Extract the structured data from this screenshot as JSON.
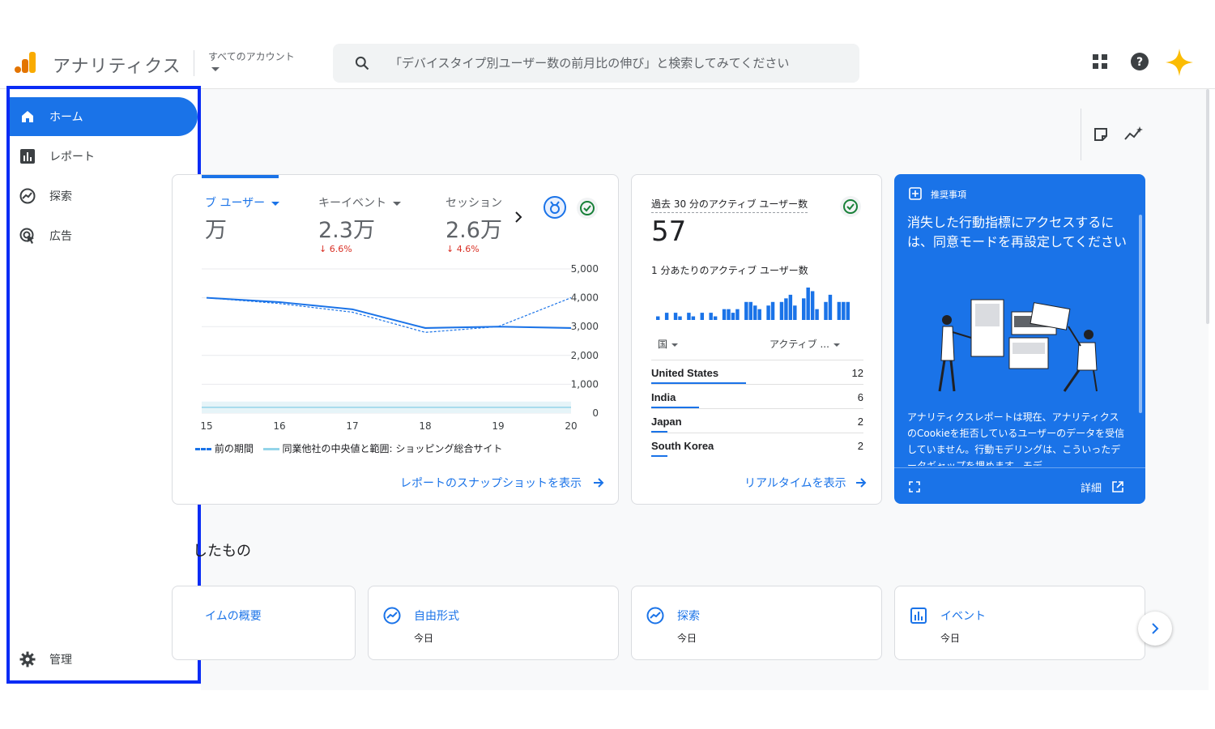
{
  "header": {
    "app_title": "アナリティクス",
    "account_label": "すべてのアカウント",
    "search_placeholder": "「デバイスタイプ別ユーザー数の前月比の伸び」と検索してみてください"
  },
  "sidebar": {
    "items": [
      {
        "label": "ホーム",
        "icon": "home-icon",
        "active": true
      },
      {
        "label": "レポート",
        "icon": "bar-chart-icon"
      },
      {
        "label": "探索",
        "icon": "explore-icon"
      },
      {
        "label": "広告",
        "icon": "ads-icon"
      }
    ],
    "admin_label": "管理"
  },
  "overview": {
    "metrics": [
      {
        "label": "ブ ユーザー",
        "value": "万"
      },
      {
        "label": "キーイベント",
        "value": "2.3万",
        "delta": "6.6%"
      },
      {
        "label": "セッション",
        "value": "2.6万",
        "delta": "4.6%"
      }
    ],
    "legend": {
      "previous": "前の期間",
      "benchmark": "同業他社の中央値と範囲: ショッピング総合サイト"
    },
    "link": "レポートのスナップショットを表示"
  },
  "chart_data": {
    "type": "line",
    "x": [
      "15",
      "16",
      "17",
      "18",
      "19",
      "20"
    ],
    "yticks": [
      "5,000",
      "4,000",
      "3,000",
      "2,000",
      "1,000",
      "0"
    ],
    "ylim": [
      0,
      5000
    ],
    "series": [
      {
        "name": "",
        "values": [
          4000,
          3850,
          3600,
          2950,
          3000,
          2950
        ]
      },
      {
        "name": "前の期間",
        "values": [
          4000,
          3800,
          3500,
          2800,
          3000,
          4000
        ]
      }
    ]
  },
  "realtime": {
    "title": "過去 30 分のアクティブ ユーザー数",
    "value": "57",
    "subtitle": "1 分あたりのアクティブ ユーザー数",
    "bars": [
      1,
      0,
      2,
      0,
      2,
      1,
      0,
      2,
      1,
      0,
      2,
      0,
      2,
      1,
      0,
      3,
      3,
      2,
      3,
      0,
      5,
      5,
      4,
      3,
      0,
      4,
      5,
      0,
      5,
      6,
      7,
      4,
      0,
      6,
      9,
      8,
      3,
      0,
      5,
      7,
      0,
      5,
      5,
      5
    ],
    "col_country": "国",
    "col_active": "アクティブ ...",
    "countries": [
      {
        "name": "United States",
        "value": "12",
        "frac": 1.0
      },
      {
        "name": "India",
        "value": "6",
        "frac": 0.5
      },
      {
        "name": "Japan",
        "value": "2",
        "frac": 0.17
      },
      {
        "name": "South Korea",
        "value": "2",
        "frac": 0.17
      }
    ],
    "link": "リアルタイムを表示"
  },
  "recommendation": {
    "label": "推奨事項",
    "title": "消失した行動指標にアクセスするには、同意モードを再設定してください",
    "body": "アナリティクスレポートは現在、アナリティクスのCookieを拒否しているユーザーのデータを受信していません。行動モデリングは、こういったデータギャップを埋めます。モデ",
    "details": "詳細"
  },
  "section_title": "したもの",
  "shortcuts": [
    {
      "title": "イムの概要",
      "sub": ""
    },
    {
      "title": "自由形式",
      "sub": "今日"
    },
    {
      "title": "探索",
      "sub": "今日"
    },
    {
      "title": "イベント",
      "sub": "今日"
    }
  ]
}
